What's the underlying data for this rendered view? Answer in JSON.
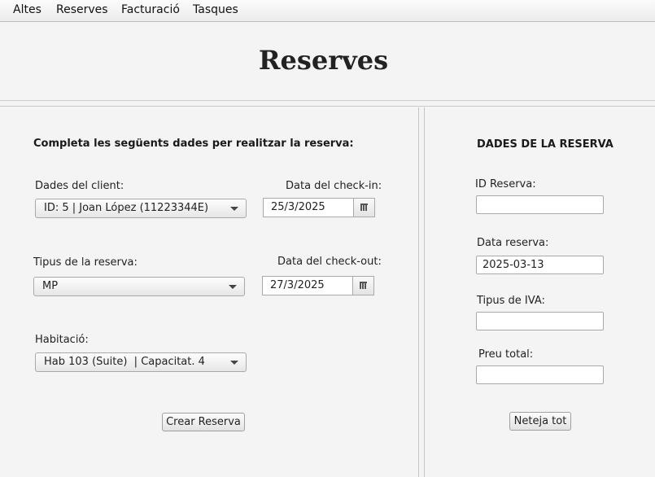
{
  "menu": {
    "items": [
      "Altes",
      "Reserves",
      "Facturació",
      "Tasques"
    ]
  },
  "page": {
    "title": "Reserves"
  },
  "form": {
    "heading": "Completa les següents dades per realitzar la reserva:",
    "client_label": "Dades del client:",
    "client_value": "ID: 5 | Joan López (11223344E)",
    "checkin_label": "Data del check-in:",
    "checkin_value": "25/3/2025",
    "tipus_label": "Tipus de la reserva:",
    "tipus_value": "MP",
    "checkout_label": "Data del check-out:",
    "checkout_value": "27/3/2025",
    "habitacio_label": "Habitació:",
    "habitacio_value": "Hab 103 (Suite)  | Capacitat. 4",
    "create_button": "Crear Reserva"
  },
  "summary": {
    "heading": "DADES DE LA RESERVA",
    "id_label": "ID Reserva:",
    "id_value": "",
    "data_label": "Data reserva:",
    "data_value": "2025-03-13",
    "iva_label": "Tipus de IVA:",
    "iva_value": "",
    "preu_label": "Preu total:",
    "preu_value": "",
    "clear_button": "Neteja tot"
  }
}
